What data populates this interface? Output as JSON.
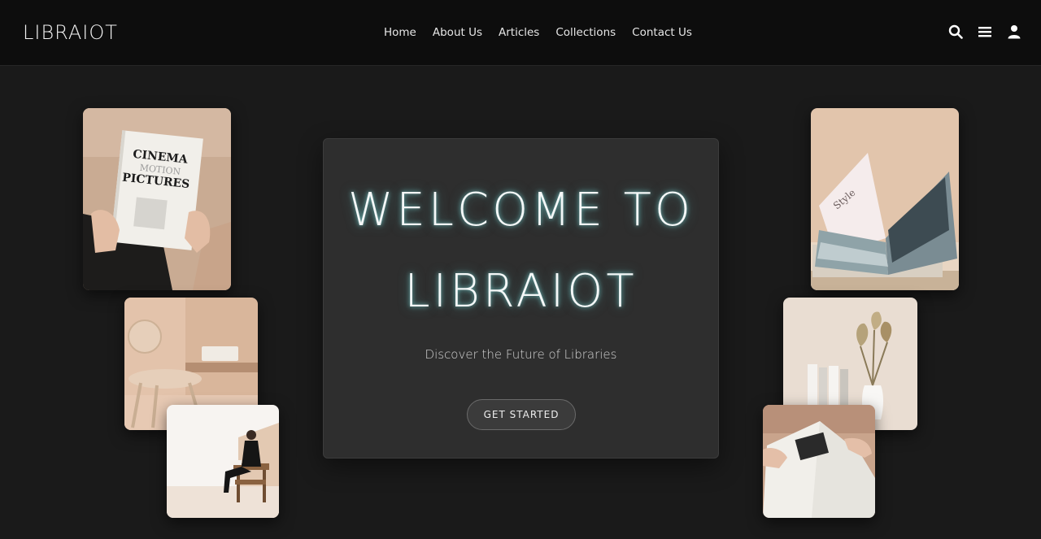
{
  "brand": "LIBRAIOT",
  "nav": {
    "items": [
      {
        "label": "Home"
      },
      {
        "label": "About Us"
      },
      {
        "label": "Articles"
      },
      {
        "label": "Collections"
      },
      {
        "label": "Contact Us"
      }
    ]
  },
  "header_icons": [
    "search-icon",
    "menu-icon",
    "user-icon"
  ],
  "hero": {
    "title_line1": "WELCOME TO",
    "title_line2": "LIBRAIOT",
    "subtitle": "Discover the Future of Libraries",
    "cta_label": "GET STARTED"
  },
  "photos": {
    "cinema_book": {
      "line1": "CINEMA",
      "line2": "MOTION",
      "line3": "PICTURES"
    },
    "style_book": {
      "cover_text": "Style"
    }
  },
  "colors": {
    "background": "#1a1a1a",
    "header": "#0d0d0d",
    "card": "#2e2e2e",
    "title_glow": "#78d2d2"
  }
}
